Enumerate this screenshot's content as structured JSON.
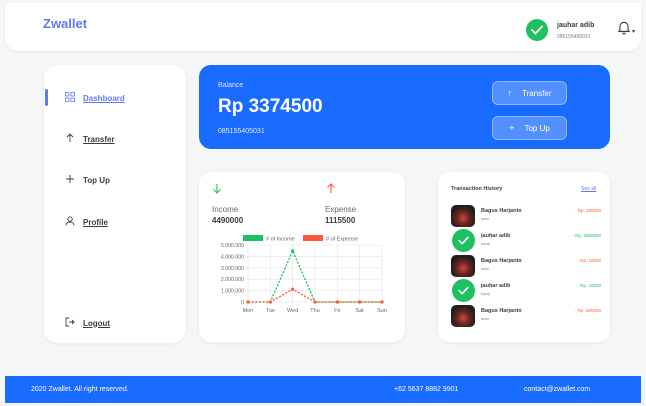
{
  "brand": "Zwallet",
  "user": {
    "name": "jauhar adib",
    "phone": "085155405031"
  },
  "nav": {
    "dashboard": "Dashboard",
    "transfer": "Transfer",
    "topup": "Top Up",
    "profile": "Profile",
    "logout": "Logout"
  },
  "balance": {
    "label": "Balance",
    "amount": "Rp 3374500",
    "phone": "085155405031",
    "transfer_label": "Transfer",
    "topup_label": "Top Up"
  },
  "summary": {
    "income_label": "Income",
    "income_value": "4490000",
    "expense_label": "Expense",
    "expense_value": "1115500"
  },
  "chart_data": {
    "type": "line",
    "categories": [
      "Mon",
      "Tue",
      "Wed",
      "Thu",
      "Fri",
      "Sat",
      "Sun"
    ],
    "series": [
      {
        "name": "# of Income",
        "values": [
          0,
          0,
          4490000,
          0,
          0,
          0,
          0
        ],
        "color": "#1ec15f"
      },
      {
        "name": "# of Expense",
        "values": [
          0,
          0,
          1115500,
          0,
          0,
          0,
          0
        ],
        "color": "#ff5b37"
      }
    ],
    "yticks": [
      "0",
      "1.000.000",
      "2.000.000",
      "3.000.000",
      "4.000.000",
      "5.000.000"
    ],
    "ylim": [
      0,
      5000000
    ],
    "grid": true,
    "legend": "top"
  },
  "transactions": {
    "title": "Transaction History",
    "see_all": "See all",
    "items": [
      {
        "name": "Bagus Harjanto",
        "type": "send",
        "amount": "- Rp. 100000",
        "amount_color": "#ff5b37",
        "avatar": "photo"
      },
      {
        "name": "jauhar adib",
        "type": "topup",
        "amount": "- Rp. 3350000",
        "amount_color": "#1ec15f",
        "avatar": "check"
      },
      {
        "name": "Bagus Harjanto",
        "type": "send",
        "amount": "- Rp. 15500",
        "amount_color": "#ff5b37",
        "avatar": "photo"
      },
      {
        "name": "jauhar adib",
        "type": "topup",
        "amount": "- Rp. 15000",
        "amount_color": "#1ec15f",
        "avatar": "check"
      },
      {
        "name": "Bagus Harjanto",
        "type": "send",
        "amount": "- Rp. 500000",
        "amount_color": "#ff5b37",
        "avatar": "photo"
      }
    ]
  },
  "footer": {
    "copyright": "2020 Zwallet. All right reserved.",
    "phone": "+62 5637 8882 9901",
    "email": "contact@zwallet.com"
  },
  "colors": {
    "accent": "#6379f4",
    "primary": "#1a6bff",
    "income": "#1ec15f",
    "expense": "#ff5b37"
  }
}
